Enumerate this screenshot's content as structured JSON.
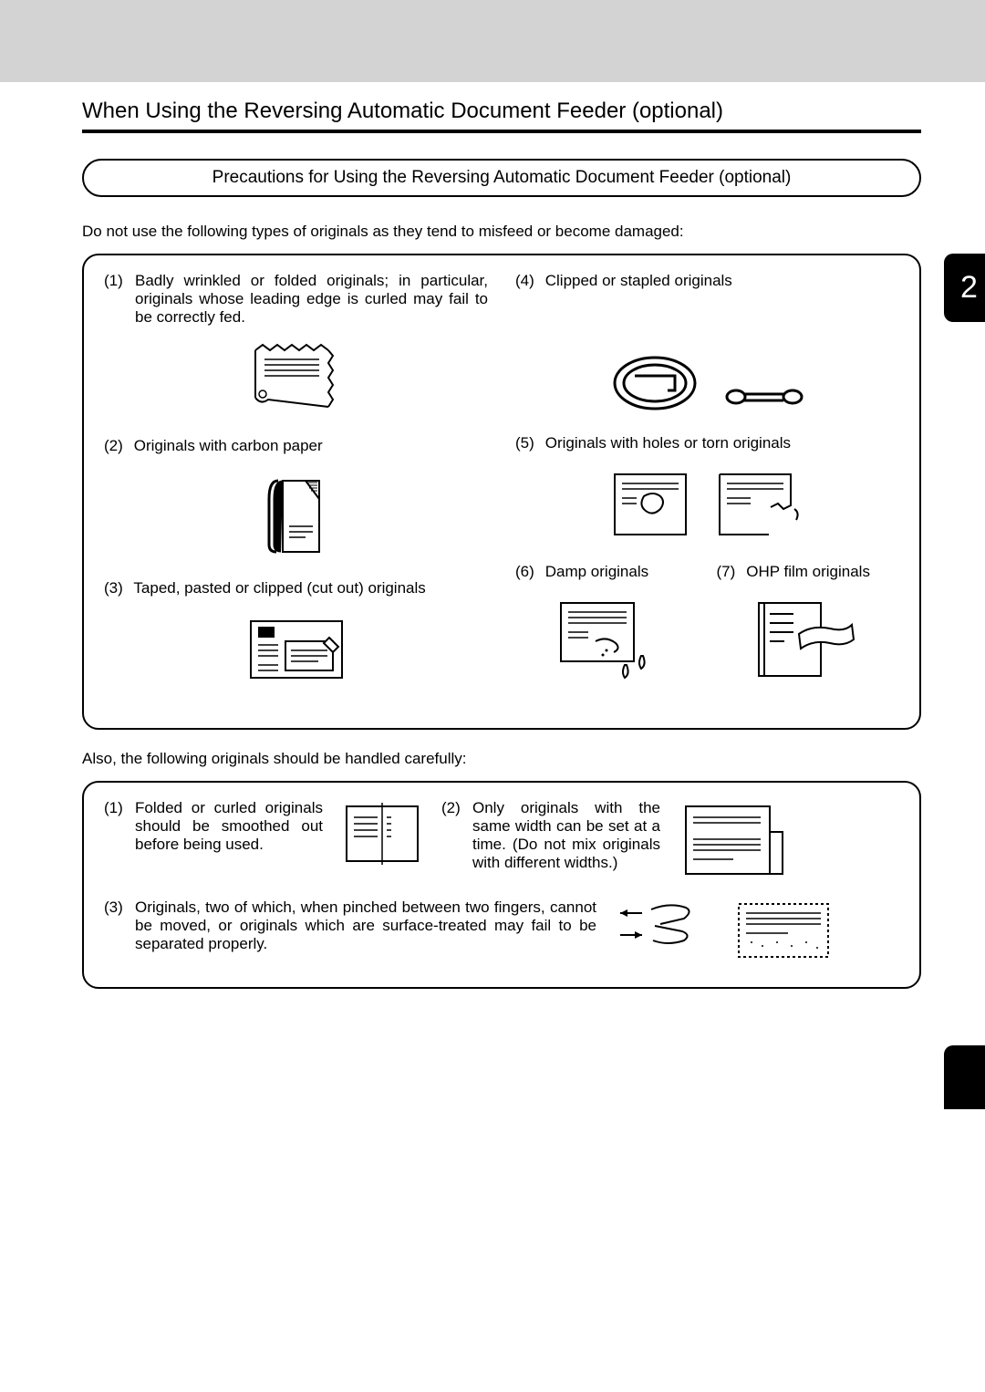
{
  "chapter_number": "2",
  "page_title": "When Using the Reversing Automatic Document Feeder (optional)",
  "pill_title": "Precautions for Using the Reversing Automatic Document Feeder (optional)",
  "intro1": "Do not use the following types of originals as they tend to misfeed or become damaged:",
  "items": {
    "i1": {
      "num": "(1)",
      "text": "Badly wrinkled or folded originals; in particular, originals whose leading edge is curled may fail to be correctly fed."
    },
    "i2": {
      "num": "(2)",
      "text": "Originals with carbon paper"
    },
    "i3": {
      "num": "(3)",
      "text": "Taped, pasted or clipped (cut out) originals"
    },
    "i4": {
      "num": "(4)",
      "text": "Clipped or stapled originals"
    },
    "i5": {
      "num": "(5)",
      "text": "Originals with holes or torn originals"
    },
    "i6": {
      "num": "(6)",
      "text": "Damp originals"
    },
    "i7": {
      "num": "(7)",
      "text": "OHP film originals"
    }
  },
  "intro2": "Also, the following originals should be handled carefully:",
  "carefuls": {
    "c1": {
      "num": "(1)",
      "text": "Folded or curled originals should be smoothed out before being used."
    },
    "c2": {
      "num": "(2)",
      "text": "Only originals with the same width can be set at a time. (Do not mix originals with different widths.)"
    },
    "c3": {
      "num": "(3)",
      "text": "Originals, two of which, when pinched between two fingers, cannot be moved, or originals which are surface-treated may fail to be separated properly."
    }
  }
}
